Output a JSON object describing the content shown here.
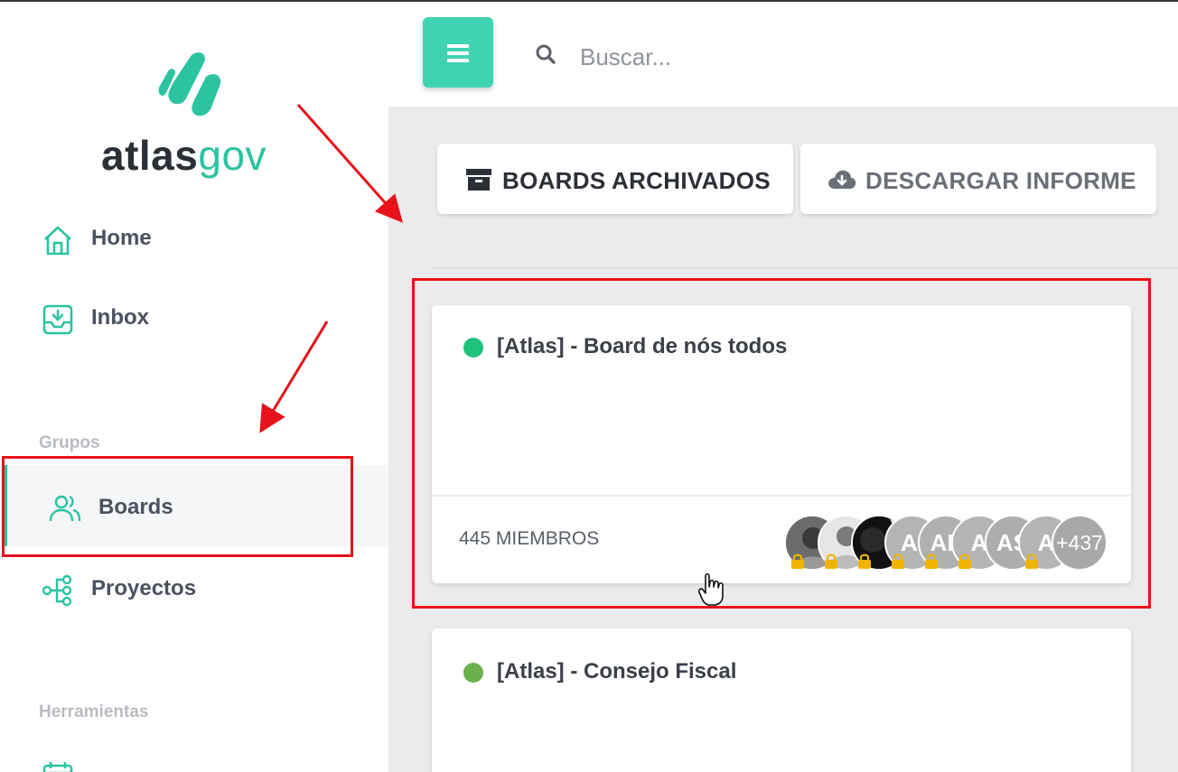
{
  "brand": {
    "logo_text_main": "atlas",
    "logo_text_accent": "gov",
    "accent_color": "#2cc3a1"
  },
  "sidebar": {
    "items": [
      {
        "label": "Home",
        "icon": "home-icon"
      },
      {
        "label": "Inbox",
        "icon": "inbox-icon"
      }
    ],
    "sections": [
      {
        "title": "Grupos",
        "items": [
          {
            "label": "Boards",
            "icon": "users-icon",
            "active": true
          },
          {
            "label": "Proyectos",
            "icon": "hierarchy-icon"
          }
        ]
      },
      {
        "title": "Herramientas",
        "items": [
          {
            "label": "",
            "icon": "calendar-icon"
          }
        ]
      }
    ]
  },
  "topbar": {
    "search_placeholder": "Buscar...",
    "menu_icon": "menu-icon",
    "search_icon": "search-icon"
  },
  "actions": {
    "archived_label": "BOARDS ARCHIVADOS",
    "archived_icon": "archive-icon",
    "download_label": "DESCARGAR INFORME",
    "download_icon": "cloud-download-icon"
  },
  "boards": [
    {
      "title": "[Atlas] - Board de nós todos",
      "status_color": "#1fc27c",
      "members": "445 MIEMBROS",
      "avatars": [
        "",
        "",
        "",
        "AI",
        "AF",
        "A",
        "AS",
        "A"
      ],
      "more": "+437"
    },
    {
      "title": "[Atlas] - Consejo Fiscal",
      "status_color": "#6ab04c"
    }
  ],
  "colors": {
    "annotation_red": "#e8121b",
    "menu_button": "#3fd3b2",
    "lock": "#f0b400"
  }
}
